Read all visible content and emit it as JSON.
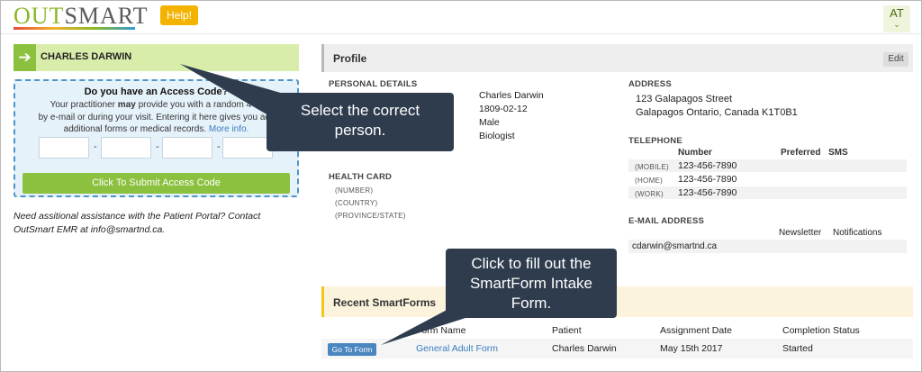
{
  "header": {
    "logo_part1": "OUT",
    "logo_part2": "SMART",
    "help_label": "Help!",
    "user_initials": "AT"
  },
  "patient": {
    "name": "CHARLES DARWIN"
  },
  "access_code": {
    "title": "Do you have an Access Code?",
    "text_line1_a": "Your practitioner ",
    "text_line1_bold": "may",
    "text_line1_b": " provide you with a random 4-4-",
    "text_line2": "by e-mail or during your visit. Entering it here gives you acc",
    "text_line3": "additional forms or medical records.",
    "more_info": "More info.",
    "dash": "-",
    "submit_label": "Click To Submit Access Code"
  },
  "assistance_text": "Need assitional assistance with the Patient Portal? Contact OutSmart EMR at info@smartnd.ca.",
  "profile": {
    "title": "Profile",
    "edit_label": "Edit",
    "personal_details_heading": "PERSONAL DETAILS",
    "name": "Charles Darwin",
    "dob": "1809-02-12",
    "gender": "Male",
    "occupation": "Biologist",
    "health_card_heading": "HEALTH CARD",
    "health_card_fields": [
      "(NUMBER)",
      "(COUNTRY)",
      "(PROVINCE/STATE)"
    ],
    "address_heading": "ADDRESS",
    "address_line1": "123 Galapagos Street",
    "address_line2": "Galapagos Ontario, Canada K1T0B1",
    "telephone_heading": "TELEPHONE",
    "phone_columns": [
      "Number",
      "Preferred",
      "SMS"
    ],
    "phones": [
      {
        "type": "(MOBILE)",
        "number": "123-456-7890"
      },
      {
        "type": "(HOME)",
        "number": "123-456-7890"
      },
      {
        "type": "(WORK)",
        "number": "123-456-7890"
      }
    ],
    "email_heading": "E-MAIL ADDRESS",
    "email_columns": [
      "Newsletter",
      "Notifications"
    ],
    "email": "cdarwin@smartnd.ca"
  },
  "smartforms": {
    "title": "Recent SmartForms",
    "columns": [
      "Form Name",
      "Patient",
      "Assignment Date",
      "Completion Status"
    ],
    "rows": [
      {
        "action": "Go To Form",
        "form_name": "General Adult Form",
        "patient": "Charles Darwin",
        "assignment_date": "May 15th 2017",
        "status": "Started"
      }
    ]
  },
  "callouts": {
    "select_person": "Select the correct person.",
    "fill_form": "Click to fill out the SmartForm Intake Form."
  },
  "colors": {
    "accent_green": "#8cc13f",
    "help_yellow": "#f5b301",
    "callout_bg": "#2e3c4e",
    "link_blue": "#3a7dc0"
  }
}
